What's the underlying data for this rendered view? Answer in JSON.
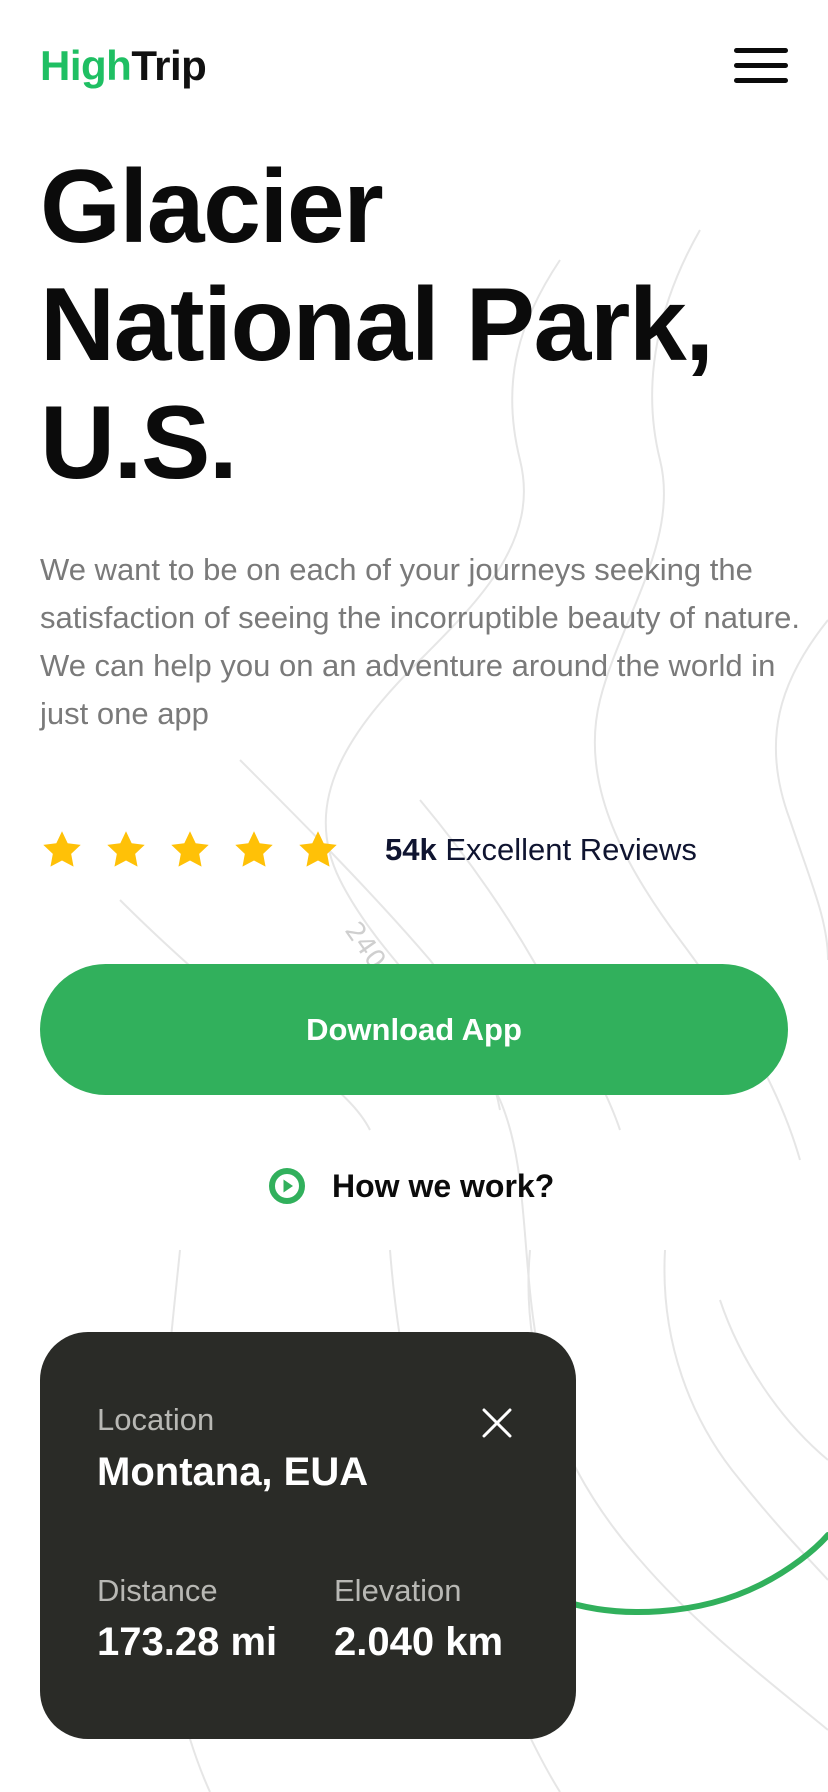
{
  "header": {
    "logo_high": "High",
    "logo_trip": "Trip"
  },
  "hero": {
    "title_lines": [
      "Glacier",
      "National Park,",
      "U.S."
    ],
    "description": "We want to be on each of your journeys seeking the satisfaction of seeing the incorruptible beauty of nature. We can help you on an adventure around the world in just one app"
  },
  "rating": {
    "stars": 5,
    "count": "54k",
    "label": "Excellent Reviews"
  },
  "cta": {
    "download_label": "Download App",
    "how_label": "How we work?"
  },
  "map": {
    "contour_label": "240"
  },
  "card": {
    "location_label": "Location",
    "location_value": "Montana, EUA",
    "distance_label": "Distance",
    "distance_value": "173.28 mi",
    "elevation_label": "Elevation",
    "elevation_value": "2.040 km"
  },
  "colors": {
    "brand_green": "#31b05c",
    "logo_green": "#1fbf63",
    "star_yellow": "#ffc107",
    "card_bg": "#2a2b27"
  }
}
